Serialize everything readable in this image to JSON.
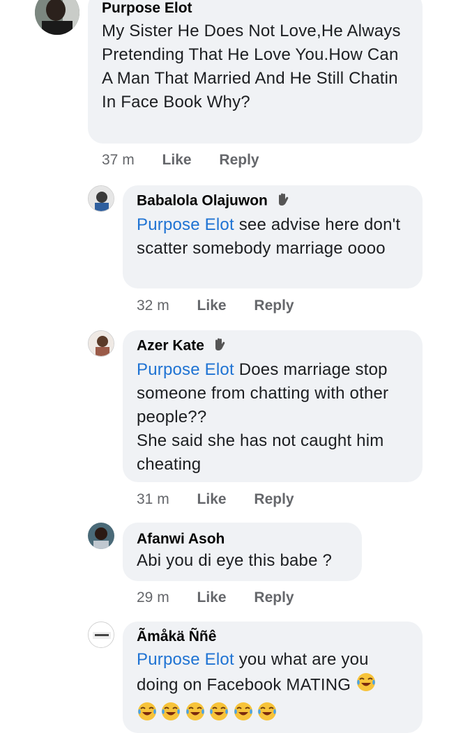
{
  "comments": [
    {
      "author": "Purpose Elot",
      "text": "My Sister He Does Not Love,He Always Pretending That He Love You.How Can A Man That Married And He Still Chatin In Face Book Why?",
      "time": "37 m",
      "like": "Like",
      "reply": "Reply"
    }
  ],
  "replies": [
    {
      "author": "Babalola Olajuwon",
      "mention": "Purpose Elot",
      "text": " see advise here don't scatter somebody marriage oooo",
      "time": "32 m",
      "like": "Like",
      "reply": "Reply",
      "badge_icon": "wave-icon"
    },
    {
      "author": "Azer Kate",
      "mention": "Purpose Elot",
      "text": " Does marriage stop someone from chatting with other people??",
      "text2": "She said she has not caught him cheating",
      "time": "31 m",
      "like": "Like",
      "reply": "Reply",
      "badge_icon": "wave-icon"
    },
    {
      "author": "Afanwi Asoh",
      "text": "Abi you di eye this babe ?",
      "time": "29 m",
      "like": "Like",
      "reply": "Reply"
    },
    {
      "author": "Ãmåkä Ññê",
      "mention": "Purpose Elot",
      "text": " you what are you doing on Facebook  MATING",
      "emoji_icon": "tears-of-joy-emoji"
    }
  ],
  "colors": {
    "bubble": "#f0f2f5",
    "mention": "#1f73d3",
    "meta": "#65676b"
  }
}
